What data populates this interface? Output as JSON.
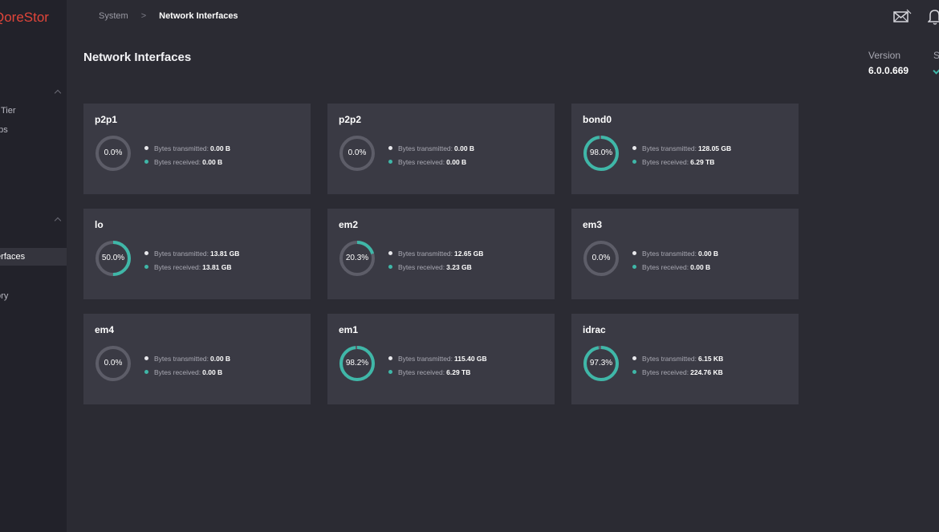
{
  "app": {
    "logo_text": "QoreStor"
  },
  "sidebar": {
    "items": [
      {
        "label": "e Tier",
        "active": false
      },
      {
        "label": "ups",
        "active": false
      },
      {
        "label": "terfaces",
        "active": true
      },
      {
        "label": "tory",
        "active": false
      }
    ]
  },
  "breadcrumb": {
    "parent": "System",
    "separator": ">",
    "current": "Network Interfaces"
  },
  "header": {
    "title": "Network Interfaces",
    "version_label": "Version",
    "version_value": "6.0.0.669",
    "status_label": "S"
  },
  "labels": {
    "transmitted": "Bytes transmitted:",
    "received": "Bytes received:"
  },
  "colors": {
    "accent": "#3fb7a8",
    "ring_track": "#5d5d68",
    "card_bg": "#3a3a44",
    "logo": "#e0453a"
  },
  "icons": {
    "mail": "mail-icon",
    "bell": "bell-icon",
    "status": "check-icon"
  },
  "interfaces": [
    {
      "name": "p2p1",
      "percent": 0.0,
      "percent_label": "0.0%",
      "transmitted": "0.00 B",
      "received": "0.00 B"
    },
    {
      "name": "p2p2",
      "percent": 0.0,
      "percent_label": "0.0%",
      "transmitted": "0.00 B",
      "received": "0.00 B"
    },
    {
      "name": "bond0",
      "percent": 98.0,
      "percent_label": "98.0%",
      "transmitted": "128.05 GB",
      "received": "6.29 TB"
    },
    {
      "name": "lo",
      "percent": 50.0,
      "percent_label": "50.0%",
      "transmitted": "13.81 GB",
      "received": "13.81 GB"
    },
    {
      "name": "em2",
      "percent": 20.3,
      "percent_label": "20.3%",
      "transmitted": "12.65 GB",
      "received": "3.23 GB"
    },
    {
      "name": "em3",
      "percent": 0.0,
      "percent_label": "0.0%",
      "transmitted": "0.00 B",
      "received": "0.00 B"
    },
    {
      "name": "em4",
      "percent": 0.0,
      "percent_label": "0.0%",
      "transmitted": "0.00 B",
      "received": "0.00 B"
    },
    {
      "name": "em1",
      "percent": 98.2,
      "percent_label": "98.2%",
      "transmitted": "115.40 GB",
      "received": "6.29 TB"
    },
    {
      "name": "idrac",
      "percent": 97.3,
      "percent_label": "97.3%",
      "transmitted": "6.15 KB",
      "received": "224.76 KB"
    }
  ]
}
